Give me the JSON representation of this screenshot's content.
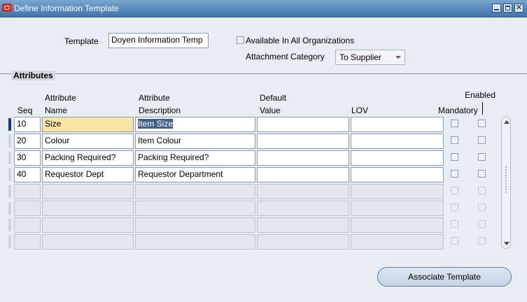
{
  "window": {
    "title": "Define Information Template"
  },
  "form": {
    "template_label": "Template",
    "template_value": "Doyen Information Temp",
    "available_all_orgs_label": "Available In All Organizations",
    "attachment_category_label": "Attachment Category",
    "attachment_category_value": "To Supplier"
  },
  "attributes": {
    "section_title": "Attributes",
    "headers": {
      "seq": "Seq",
      "attr_name_1": "Attribute",
      "attr_name_2": "Name",
      "attr_desc_1": "Attribute",
      "attr_desc_2": "Description",
      "default_1": "Default",
      "default_2": "Value",
      "lov": "LOV",
      "mandatory": "Mandatory",
      "enabled": "Enabled"
    },
    "rows": [
      {
        "seq": "10",
        "name": "Size",
        "description": "Item Size",
        "default_value": "",
        "lov": ""
      },
      {
        "seq": "20",
        "name": "Colour",
        "description": "Item Colour",
        "default_value": "",
        "lov": ""
      },
      {
        "seq": "30",
        "name": "Packing Required?",
        "description": "Packing Required?",
        "default_value": "",
        "lov": ""
      },
      {
        "seq": "40",
        "name": "Requestor Dept",
        "description": "Requestor Department",
        "default_value": "",
        "lov": ""
      }
    ]
  },
  "buttons": {
    "associate_template": "Associate Template"
  },
  "colors": {
    "titlebar": "#3f74ae",
    "selected_field": "#f9e4a8",
    "background": "#e8edf3"
  }
}
